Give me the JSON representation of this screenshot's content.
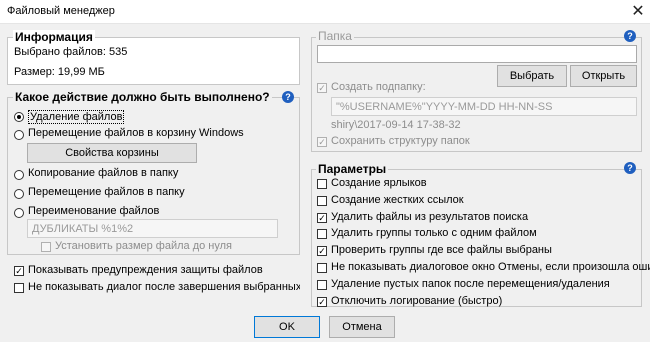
{
  "window": {
    "title": "Файловый менеджер",
    "close_glyph": "✕"
  },
  "info": {
    "title": "Информация",
    "selected": "Выбрано файлов: 535",
    "size": "Размер: 19,99 МБ"
  },
  "action": {
    "title": "Какое действие должно быть выполнено?",
    "help": "?",
    "delete": "Удаление файлов",
    "recycle": "Перемещение файлов в корзину Windows",
    "recycle_props": "Свойства корзины",
    "copy": "Копирование файлов в папку",
    "move": "Перемещение файлов в папку",
    "rename": "Переименование файлов",
    "rename_pattern": "ДУБЛИКАТЫ %1%2",
    "zero_size": "Установить размер файла до нуля",
    "show_warnings": "Показывать предупреждения защиты файлов",
    "no_dialog": "Не показывать диалог после завершения выбранных действий"
  },
  "folder": {
    "title": "Папка",
    "help": "?",
    "path": "",
    "choose": "Выбрать",
    "open": "Открыть",
    "create_subfolder": "Создать подпапку:",
    "subfolder_pattern": "\"%USERNAME%\"YYYY-MM-DD HH-NN-SS",
    "subfolder_preview": "shiry\\2017-09-14 17-38-32",
    "keep_structure": "Сохранить структуру папок"
  },
  "params": {
    "title": "Параметры",
    "help": "?",
    "items": [
      {
        "label": "Создание ярлыков",
        "checked": false
      },
      {
        "label": "Создание жестких ссылок",
        "checked": false
      },
      {
        "label": "Удалить файлы из результатов поиска",
        "checked": true
      },
      {
        "label": "Удалить группы только с одним файлом",
        "checked": false
      },
      {
        "label": "Проверить группы где все файлы выбраны",
        "checked": true
      },
      {
        "label": "Не показывать диалоговое окно Отмены, если произошла ошибка",
        "checked": false
      },
      {
        "label": "Удаление пустых папок после перемещения/удаления",
        "checked": false
      },
      {
        "label": "Отключить логирование (быстро)",
        "checked": true
      }
    ]
  },
  "footer": {
    "ok": "OK",
    "cancel": "Отмена"
  },
  "colors": {
    "accent": "#0078d7",
    "help_icon": "#1f5fbf",
    "background": "#f0f0f0"
  },
  "check_glyph": "✓"
}
